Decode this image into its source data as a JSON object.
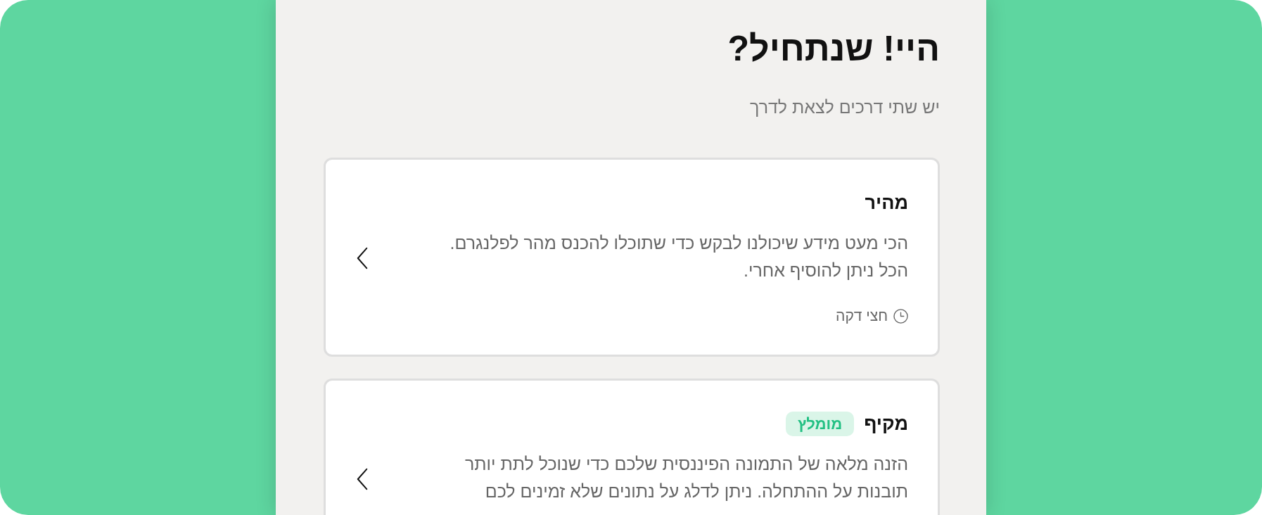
{
  "header": {
    "title": "היי! שנתחיל?",
    "subtitle": "יש שתי דרכים לצאת לדרך"
  },
  "options": [
    {
      "title": "מהיר",
      "description": "הכי מעט מידע שיכולנו לבקש כדי שתוכלו להכנס מהר לפלנגרם. הכל ניתן להוסיף אחרי.",
      "duration": "חצי דקה"
    },
    {
      "title": "מקיף",
      "badge": "מומלץ",
      "description": "הזנה מלאה של התמונה הפיננסית שלכם כדי שנוכל לתת יותר תובנות על ההתחלה. ניתן לדלג על נתונים שלא זמינים לכם"
    }
  ]
}
